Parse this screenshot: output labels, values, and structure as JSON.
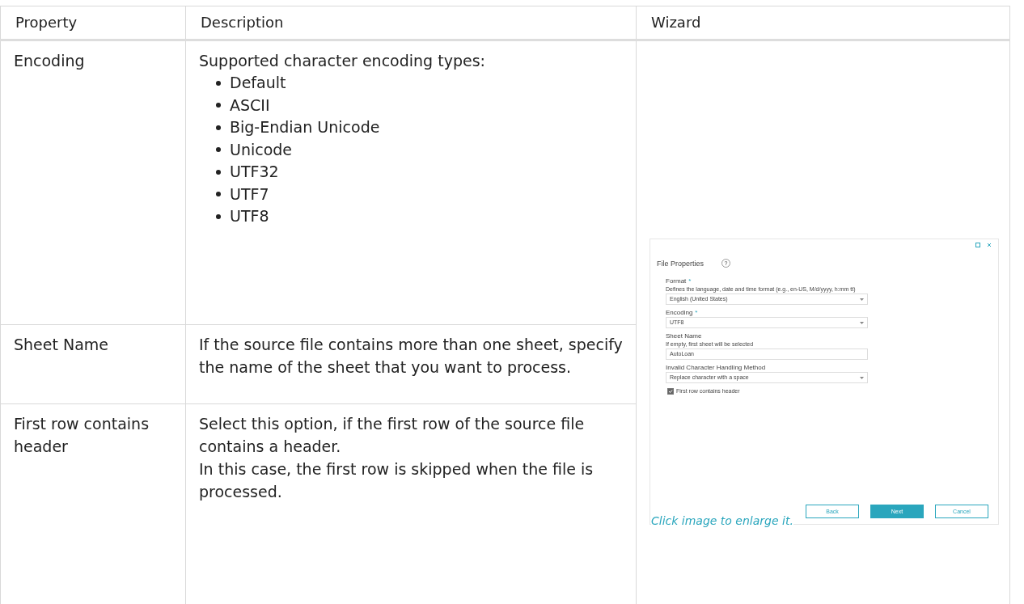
{
  "table": {
    "columns": [
      "Property",
      "Description",
      "Wizard"
    ],
    "rows": [
      {
        "property": "Encoding",
        "description": [
          "Supported character encoding types:"
        ],
        "list": [
          "Default",
          "ASCII",
          "Big-Endian Unicode",
          "Unicode",
          "UTF32",
          "UTF7",
          "UTF8"
        ]
      },
      {
        "property": "Sheet Name",
        "description": [
          "If the source file contains more than one sheet, specify the name of the sheet that you want to process."
        ]
      },
      {
        "property": "First row contains header",
        "description": [
          "Select this option, if the first row of the source file contains a header.",
          "In this case, the first row is skipped when the file is processed."
        ]
      }
    ]
  },
  "wizard": {
    "title": "File Properties",
    "help": "?",
    "fields": [
      {
        "kind": "select",
        "label": "Format",
        "required_mark": "*",
        "hint": "Defines the language, date and time format (e.g., en-US, M/d/yyyy, h:mm tt)",
        "value": "English (United States)"
      },
      {
        "kind": "select",
        "label": "Encoding",
        "required_mark": "*",
        "value": "UTF8"
      },
      {
        "kind": "input",
        "label": "Sheet Name",
        "hint": "If empty, first sheet will be selected",
        "value": "AutoLoan"
      },
      {
        "kind": "select",
        "label": "Invalid Character Handling Method",
        "value": "Replace character with a space"
      }
    ],
    "checkbox": {
      "label": "First row contains header",
      "checked": true
    },
    "buttons": [
      {
        "label": "Back",
        "kind": "secondary"
      },
      {
        "label": "Next",
        "kind": "primary"
      },
      {
        "label": "Cancel",
        "kind": "secondary"
      }
    ]
  },
  "caption": "Click image to enlarge it."
}
